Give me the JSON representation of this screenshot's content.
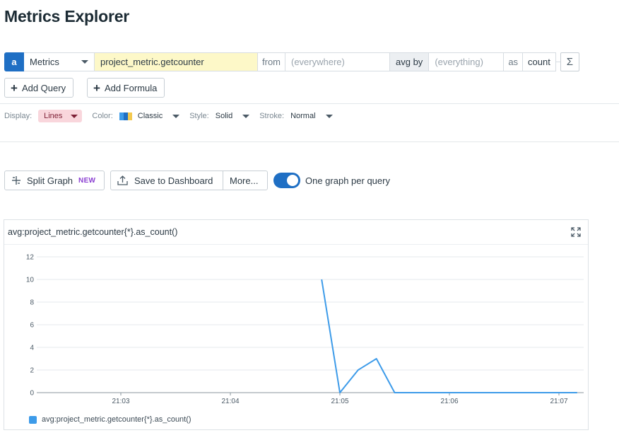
{
  "page": {
    "title": "Metrics Explorer"
  },
  "query": {
    "letter": "a",
    "source": "Metrics",
    "metric": "project_metric.getcounter",
    "from_label": "from",
    "from_placeholder": "(everywhere)",
    "avgby_label": "avg by",
    "avgby_placeholder": "(everything)",
    "as_label": "as",
    "as_value": "count",
    "sigma": "Σ"
  },
  "actions": {
    "add_query": "Add Query",
    "add_formula": "Add Formula"
  },
  "display": {
    "display_label": "Display:",
    "display_value": "Lines",
    "color_label": "Color:",
    "color_value": "Classic",
    "palette": [
      "#3d9be9",
      "#1f6fc4",
      "#f3c94f"
    ],
    "style_label": "Style:",
    "style_value": "Solid",
    "stroke_label": "Stroke:",
    "stroke_value": "Normal"
  },
  "toolbar": {
    "split_graph": "Split Graph",
    "new_badge": "NEW",
    "save_dashboard": "Save to Dashboard",
    "more": "More...",
    "one_graph_toggle": true,
    "one_graph_label": "One graph per query"
  },
  "graph": {
    "title": "avg:project_metric.getcounter{*}.as_count()",
    "legend": "avg:project_metric.getcounter{*}.as_count()",
    "line_color": "#3d9be9"
  },
  "chart_data": {
    "type": "line",
    "title": "avg:project_metric.getcounter{*}.as_count()",
    "xlabel": "",
    "ylabel": "",
    "x_ticks": [
      "21:03",
      "21:04",
      "21:05",
      "21:06",
      "21:07"
    ],
    "y_ticks": [
      0,
      2,
      4,
      6,
      8,
      10,
      12
    ],
    "ylim": [
      0,
      12
    ],
    "grid": true,
    "series": [
      {
        "name": "avg:project_metric.getcounter{*}.as_count()",
        "x": [
          "21:04:50",
          "21:05:00",
          "21:05:10",
          "21:05:20",
          "21:05:30",
          "21:05:40",
          "21:05:50",
          "21:06:00",
          "21:06:10",
          "21:06:20",
          "21:06:30",
          "21:06:40",
          "21:06:50",
          "21:07:00",
          "21:07:10"
        ],
        "values": [
          10,
          0,
          2,
          3,
          0,
          0,
          0,
          0,
          0,
          0,
          0,
          0,
          0,
          0,
          0
        ]
      }
    ]
  }
}
